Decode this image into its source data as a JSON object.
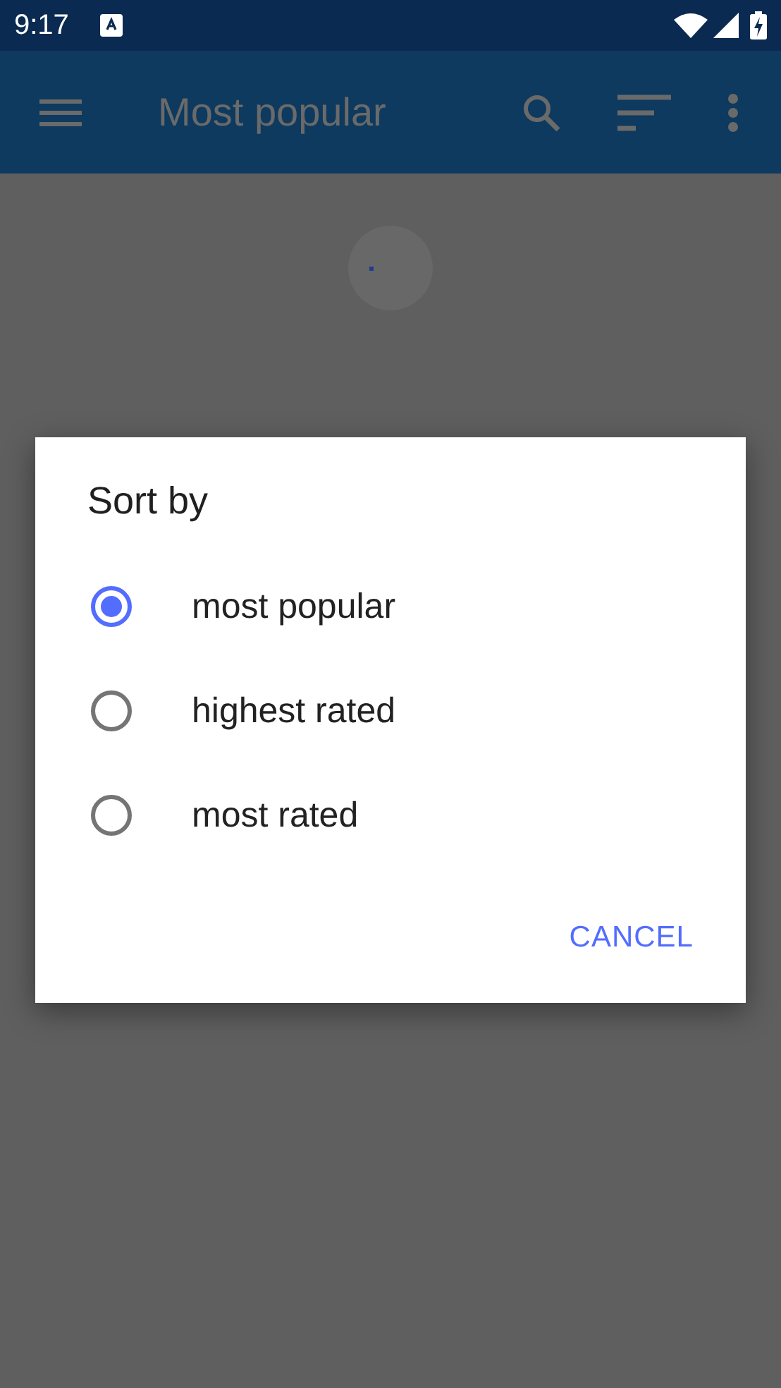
{
  "status_bar": {
    "time": "9:17"
  },
  "app_bar": {
    "title": "Most popular"
  },
  "dialog": {
    "title": "Sort by",
    "options": [
      {
        "label": "most popular",
        "selected": true
      },
      {
        "label": "highest rated",
        "selected": false
      },
      {
        "label": "most rated",
        "selected": false
      }
    ],
    "buttons": [
      "CANCEL"
    ]
  }
}
